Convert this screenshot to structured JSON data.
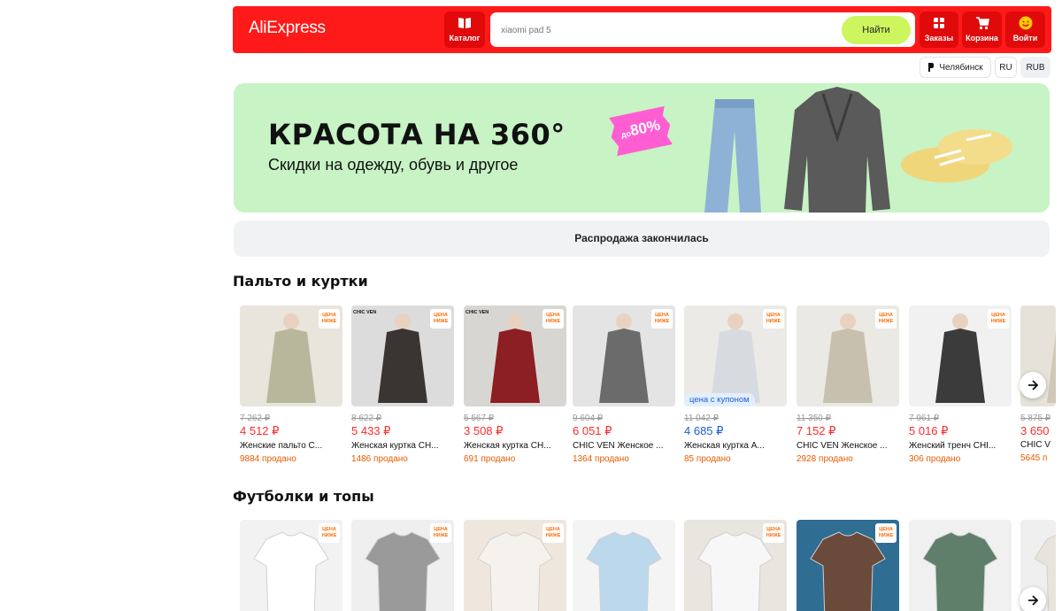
{
  "header": {
    "logo": "AliExpress",
    "catalog_label": "Каталог",
    "search_placeholder": "xiaomi pad 5",
    "search_button": "Найти",
    "orders_label": "Заказы",
    "cart_label": "Корзина",
    "login_label": "Войти",
    "brand_color": "#ff1a1a",
    "search_button_color": "#cdf55e"
  },
  "region": {
    "city": "Челябинск",
    "language": "RU",
    "currency": "RUB"
  },
  "banner": {
    "title": "КРАСОТА НА 360°",
    "subtitle": "Скидки на одежду, обувь и другое",
    "badge_prefix": "до",
    "badge_value": "80%",
    "background_color": "#c8f3c5"
  },
  "sale_status": "Распродажа закончилась",
  "sections": [
    {
      "title": "Пальто и куртки",
      "products": [
        {
          "old_price": "7 262 ₽",
          "price": "4 512 ₽",
          "name": "Женские пальто С...",
          "sold": "9884 продано",
          "tag": "ЦЕНА НИЖЕ",
          "brand": ""
        },
        {
          "old_price": "8 622 ₽",
          "price": "5 433 ₽",
          "name": "Женская куртка CH...",
          "sold": "1486 продано",
          "tag": "ЦЕНА НИЖЕ",
          "brand": "CHIC VEN"
        },
        {
          "old_price": "5 567 ₽",
          "price": "3 508 ₽",
          "name": "Женская куртка CH...",
          "sold": "691 продано",
          "tag": "ЦЕНА НИЖЕ",
          "brand": "CHIC VEN"
        },
        {
          "old_price": "9 604 ₽",
          "price": "6 051 ₽",
          "name": "CHIC VEN Женское ...",
          "sold": "1364 продано",
          "tag": "ЦЕНА НИЖЕ",
          "brand": ""
        },
        {
          "old_price": "11 042 ₽",
          "price": "4 685 ₽",
          "name": "Женская куртка А...",
          "sold": "85 продано",
          "tag": "ЦЕНА НИЖЕ",
          "brand": "",
          "coupon": "цена с купоном"
        },
        {
          "old_price": "11 350 ₽",
          "price": "7 152 ₽",
          "name": "CHIC VEN Женское ...",
          "sold": "2928 продано",
          "tag": "ЦЕНА НИЖЕ",
          "brand": ""
        },
        {
          "old_price": "7 961 ₽",
          "price": "5 016 ₽",
          "name": "Женский тренч CHI...",
          "sold": "306 продано",
          "tag": "ЦЕНА НИЖЕ",
          "brand": ""
        },
        {
          "old_price": "5 875 ₽",
          "price": "3 650",
          "name": "CHIC V",
          "sold": "5645 п",
          "tag": "",
          "brand": ""
        }
      ]
    },
    {
      "title": "Футболки и топы",
      "products": [
        {
          "tag": "ЦЕНА НИЖЕ"
        },
        {
          "tag": "ЦЕНА НИЖЕ"
        },
        {
          "tag": "ЦЕНА НИЖЕ"
        },
        {
          "tag": ""
        },
        {
          "tag": "ЦЕНА НИЖЕ"
        },
        {
          "tag": "ЦЕНА НИЖЕ"
        },
        {
          "tag": ""
        },
        {
          "tag": ""
        }
      ]
    }
  ]
}
